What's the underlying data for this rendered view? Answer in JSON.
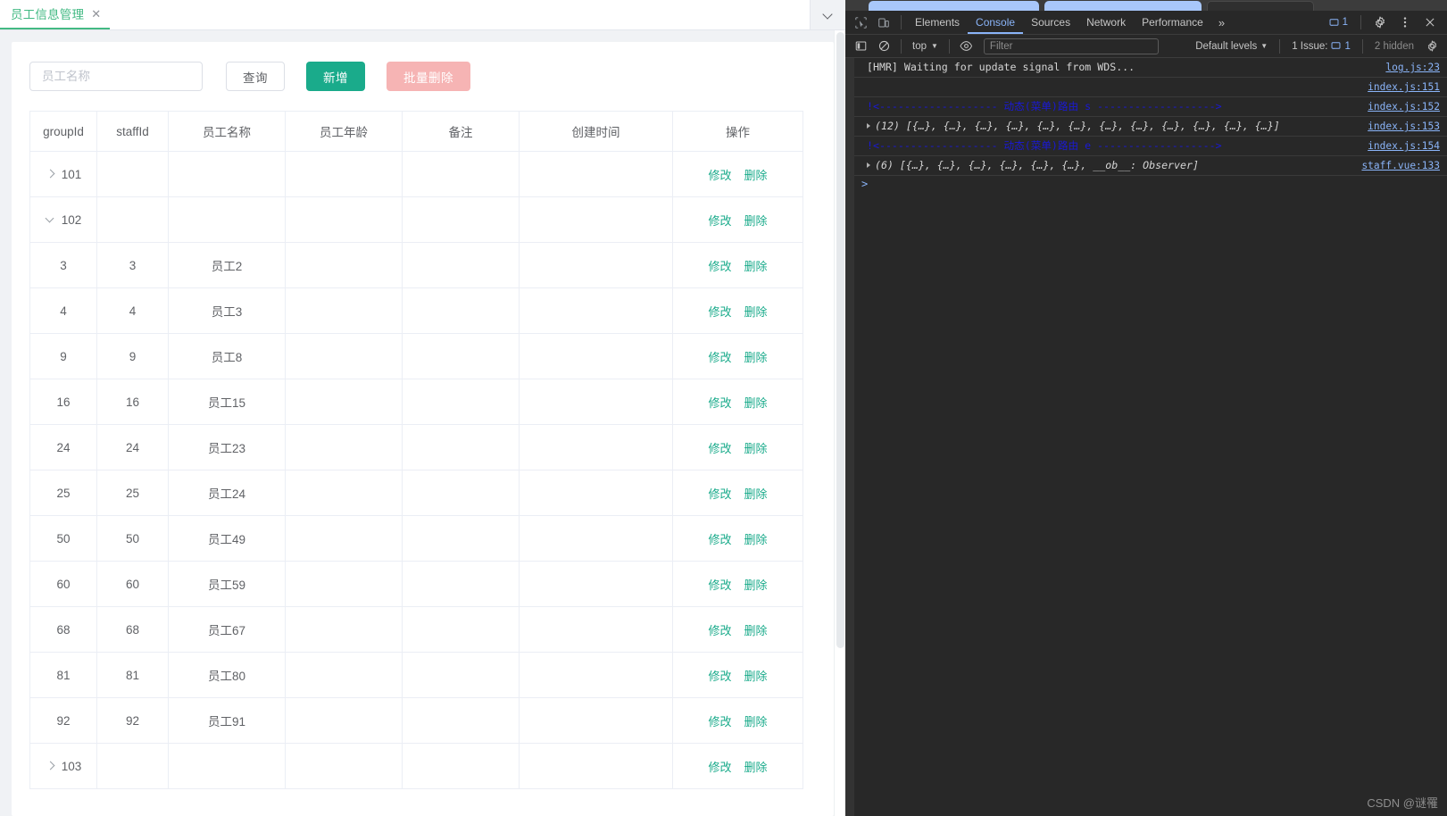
{
  "page": {
    "tab": {
      "label": "员工信息管理",
      "close_icon": "close-icon"
    },
    "tabs_overflow_icon": "chevron-down-icon",
    "toolbar": {
      "search_placeholder": "员工名称",
      "search_value": "",
      "query_label": "查询",
      "add_label": "新增",
      "batch_delete_label": "批量删除"
    },
    "table": {
      "columns": [
        "groupId",
        "staffId",
        "员工名称",
        "员工年龄",
        "备注",
        "创建时间",
        "操作"
      ],
      "action_edit": "修改",
      "action_delete": "删除",
      "rows": [
        {
          "groupId": "101",
          "staffId": "",
          "name": "",
          "age": "",
          "remark": "",
          "created": "",
          "group": true,
          "expanded": false
        },
        {
          "groupId": "102",
          "staffId": "",
          "name": "",
          "age": "",
          "remark": "",
          "created": "",
          "group": true,
          "expanded": true
        },
        {
          "groupId": "3",
          "staffId": "3",
          "name": "员工2",
          "age": "",
          "remark": "",
          "created": "",
          "group": false
        },
        {
          "groupId": "4",
          "staffId": "4",
          "name": "员工3",
          "age": "",
          "remark": "",
          "created": "",
          "group": false
        },
        {
          "groupId": "9",
          "staffId": "9",
          "name": "员工8",
          "age": "",
          "remark": "",
          "created": "",
          "group": false
        },
        {
          "groupId": "16",
          "staffId": "16",
          "name": "员工15",
          "age": "",
          "remark": "",
          "created": "",
          "group": false
        },
        {
          "groupId": "24",
          "staffId": "24",
          "name": "员工23",
          "age": "",
          "remark": "",
          "created": "",
          "group": false
        },
        {
          "groupId": "25",
          "staffId": "25",
          "name": "员工24",
          "age": "",
          "remark": "",
          "created": "",
          "group": false
        },
        {
          "groupId": "50",
          "staffId": "50",
          "name": "员工49",
          "age": "",
          "remark": "",
          "created": "",
          "group": false
        },
        {
          "groupId": "60",
          "staffId": "60",
          "name": "员工59",
          "age": "",
          "remark": "",
          "created": "",
          "group": false
        },
        {
          "groupId": "68",
          "staffId": "68",
          "name": "员工67",
          "age": "",
          "remark": "",
          "created": "",
          "group": false
        },
        {
          "groupId": "81",
          "staffId": "81",
          "name": "员工80",
          "age": "",
          "remark": "",
          "created": "",
          "group": false
        },
        {
          "groupId": "92",
          "staffId": "92",
          "name": "员工91",
          "age": "",
          "remark": "",
          "created": "",
          "group": false
        },
        {
          "groupId": "103",
          "staffId": "",
          "name": "",
          "age": "",
          "remark": "",
          "created": "",
          "group": true,
          "expanded": false
        }
      ]
    }
  },
  "devtools": {
    "tabs": [
      {
        "label": "Elements",
        "active": false
      },
      {
        "label": "Console",
        "active": true
      },
      {
        "label": "Sources",
        "active": false
      },
      {
        "label": "Network",
        "active": false
      },
      {
        "label": "Performance",
        "active": false
      }
    ],
    "more_tabs_icon": "chevron-double-right-icon",
    "inspect_icon": "inspect-element-icon",
    "device_icon": "device-toolbar-icon",
    "issues_badge": "1",
    "settings_icon": "gear-icon",
    "kebab_icon": "more-vertical-icon",
    "close_icon": "close-icon",
    "filterbar": {
      "sidebar_icon": "console-sidebar-icon",
      "clear_icon": "clear-console-icon",
      "context": "top",
      "context_caret": "chevron-down-icon",
      "eye_icon": "live-expression-icon",
      "filter_placeholder": "Filter",
      "filter_value": "",
      "levels_label": "Default levels",
      "levels_caret": "chevron-down-icon",
      "issues_label": "1 Issue:",
      "issues_count": "1",
      "hidden_label": "2 hidden",
      "settings_icon": "gear-icon"
    },
    "messages": [
      {
        "kind": "text",
        "text": "[HMR] Waiting for update signal from WDS...",
        "source": "log.js:23"
      },
      {
        "kind": "blank",
        "text": "",
        "source": "index.js:151"
      },
      {
        "kind": "route",
        "text": "!<------------------- 动态(菜单)路由 s ------------------->",
        "source": "index.js:152"
      },
      {
        "kind": "array",
        "count": "(12)",
        "text": "[{…}, {…}, {…}, {…}, {…}, {…}, {…}, {…}, {…}, {…}, {…}, {…}]",
        "source": "index.js:153"
      },
      {
        "kind": "route",
        "text": "!<------------------- 动态(菜单)路由 e ------------------->",
        "source": "index.js:154"
      },
      {
        "kind": "array",
        "count": "(6)",
        "text": "[{…}, {…}, {…}, {…}, {…}, {…}, __ob__: Observer]",
        "source": "staff.vue:133"
      }
    ],
    "prompt_symbol": ">",
    "watermark": "CSDN @谜罹"
  },
  "colors": {
    "accent_green": "#1aab8b",
    "tab_green": "#42b983",
    "danger_light": "#f5a7a7",
    "devtools_bg": "#282828",
    "link_blue": "#8ab4f8",
    "route_blue": "#1a19d6"
  }
}
